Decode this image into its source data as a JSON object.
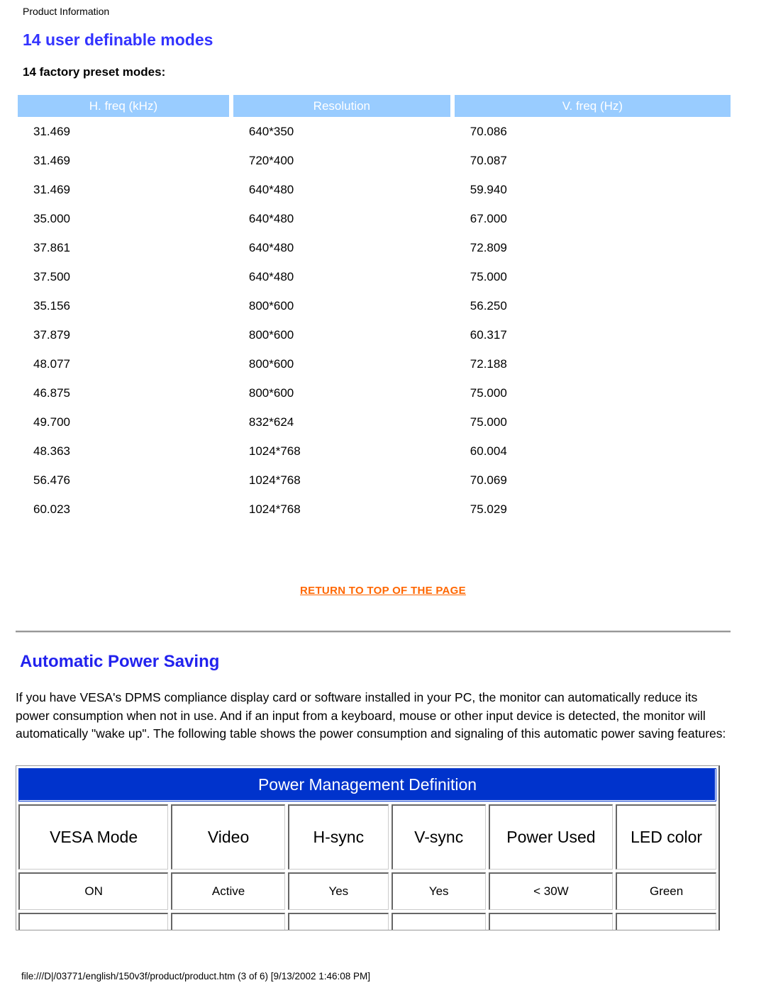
{
  "breadcrumb": "Product Information",
  "headings": {
    "title": "14 user definable modes",
    "subtitle": "14 factory preset modes:",
    "power_saving": "Automatic Power Saving"
  },
  "modes_table": {
    "columns": [
      "H. freq (kHz)",
      "Resolution",
      "V. freq (Hz)"
    ],
    "rows": [
      [
        "31.469",
        "640*350",
        "70.086"
      ],
      [
        "31.469",
        "720*400",
        "70.087"
      ],
      [
        "31.469",
        "640*480",
        "59.940"
      ],
      [
        "35.000",
        "640*480",
        "67.000"
      ],
      [
        "37.861",
        "640*480",
        "72.809"
      ],
      [
        "37.500",
        "640*480",
        "75.000"
      ],
      [
        "35.156",
        "800*600",
        "56.250"
      ],
      [
        "37.879",
        "800*600",
        "60.317"
      ],
      [
        "48.077",
        "800*600",
        "72.188"
      ],
      [
        "46.875",
        "800*600",
        "75.000"
      ],
      [
        "49.700",
        "832*624",
        "75.000"
      ],
      [
        "48.363",
        "1024*768",
        "60.004"
      ],
      [
        "56.476",
        "1024*768",
        "70.069"
      ],
      [
        "60.023",
        "1024*768",
        "75.029"
      ]
    ]
  },
  "return_to_top": "RETURN TO TOP OF THE PAGE",
  "paragraph": "If you have VESA's DPMS compliance display card or software installed in your PC, the monitor can automatically reduce its power consumption when not in use. And if an input from a keyboard, mouse or other input device is detected, the monitor will automatically \"wake up\". The following table shows the power consumption and signaling of this automatic power saving features:",
  "power_table": {
    "title": "Power Management Definition",
    "columns": [
      "VESA Mode",
      "Video",
      "H-sync",
      "V-sync",
      "Power Used",
      "LED color"
    ],
    "rows": [
      [
        "ON",
        "Active",
        "Yes",
        "Yes",
        "< 30W",
        "Green"
      ]
    ]
  },
  "footer": "file:///D|/03771/english/150v3f/product/product.htm (3 of 6) [9/13/2002 1:46:08 PM]",
  "colors": {
    "heading_blue": "#3333ff",
    "table_header_blue": "#99ccff",
    "link_orange": "#ff6600",
    "pm_title_blue": "#0033cc"
  }
}
